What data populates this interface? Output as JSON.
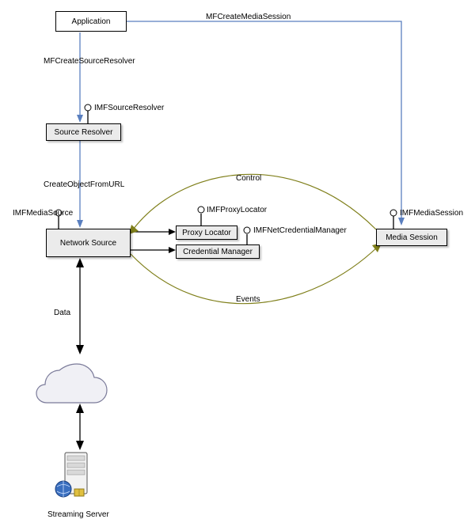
{
  "nodes": {
    "application": "Application",
    "source_resolver": "Source Resolver",
    "network_source": "Network Source",
    "proxy_locator": "Proxy Locator",
    "credential_manager": "Credential Manager",
    "media_session": "Media Session",
    "streaming_server": "Streaming Server"
  },
  "interfaces": {
    "imf_source_resolver": "IMFSourceResolver",
    "imf_media_source": "IMFMediaSource",
    "imf_proxy_locator": "IMFProxyLocator",
    "imf_net_credential_manager": "IMFNetCredentialManager",
    "imf_media_session": "IMFMediaSession"
  },
  "edges": {
    "mf_create_source_resolver": "MFCreateSourceResolver",
    "mf_create_media_session": "MFCreateMediaSession",
    "create_object_from_url": "CreateObjectFromURL",
    "control": "Control",
    "events": "Events",
    "data": "Data"
  }
}
